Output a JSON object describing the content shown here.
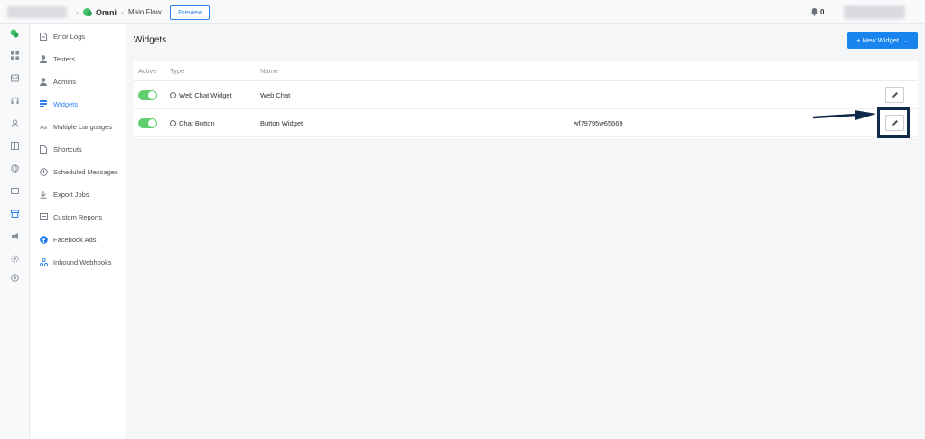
{
  "topbar": {
    "app_name": "Omni",
    "flow_name": "Main Flow",
    "preview_label": "Preview",
    "notification_count": "0"
  },
  "sidebar": {
    "items": [
      {
        "label": "Error Logs",
        "icon": "document-icon",
        "active": false
      },
      {
        "label": "Testers",
        "icon": "person-icon",
        "active": false
      },
      {
        "label": "Admins",
        "icon": "person-badge-icon",
        "active": false
      },
      {
        "label": "Widgets",
        "icon": "widgets-icon",
        "active": true
      },
      {
        "label": "Multiple Languages",
        "icon": "translate-icon",
        "active": false
      },
      {
        "label": "Shortcuts",
        "icon": "shortcut-icon",
        "active": false
      },
      {
        "label": "Scheduled Messages",
        "icon": "clock-icon",
        "active": false
      },
      {
        "label": "Export Jobs",
        "icon": "download-icon",
        "active": false
      },
      {
        "label": "Custom Reports",
        "icon": "report-icon",
        "active": false
      },
      {
        "label": "Facebook Ads",
        "icon": "facebook-icon",
        "active": false
      },
      {
        "label": "Inbound Webhooks",
        "icon": "webhook-icon",
        "active": false
      }
    ]
  },
  "main": {
    "title": "Widgets",
    "new_widget_label": "+ New Widget",
    "columns": [
      "Active",
      "Type",
      "Name"
    ],
    "rows": [
      {
        "active": true,
        "type": "Web Chat Widget",
        "name": "Web Chat",
        "id": ""
      },
      {
        "active": true,
        "type": "Chat Button",
        "name": "Button Widget",
        "id": "wf79795w65569"
      }
    ]
  },
  "colors": {
    "accent": "#1a84ee",
    "toggle_on": "#5fcf70",
    "highlight": "#0f2a4a"
  }
}
